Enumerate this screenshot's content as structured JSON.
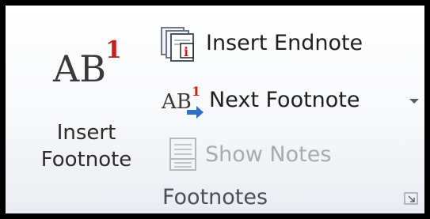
{
  "group": {
    "title": "Footnotes",
    "dialog_launcher_icon": "dialog-launcher-icon"
  },
  "buttons": {
    "insert_footnote": {
      "label_line1": "Insert",
      "label_line2": "Footnote",
      "icon_text": "AB",
      "icon_superscript": "1",
      "icon": "insert-footnote-icon"
    },
    "insert_endnote": {
      "label": "Insert Endnote",
      "icon_superscript": "i",
      "icon": "insert-endnote-icon"
    },
    "next_footnote": {
      "label": "Next Footnote",
      "icon_text": "AB",
      "icon_superscript": "1",
      "icon": "next-footnote-icon",
      "dropdown_icon": "chevron-down-icon"
    },
    "show_notes": {
      "label": "Show Notes",
      "enabled": false,
      "icon": "show-notes-icon"
    }
  },
  "colors": {
    "superscript_red": "#c8211b",
    "arrow_blue": "#2f6fc5",
    "disabled_text": "#a8aaad",
    "group_label": "#4a4f58"
  }
}
